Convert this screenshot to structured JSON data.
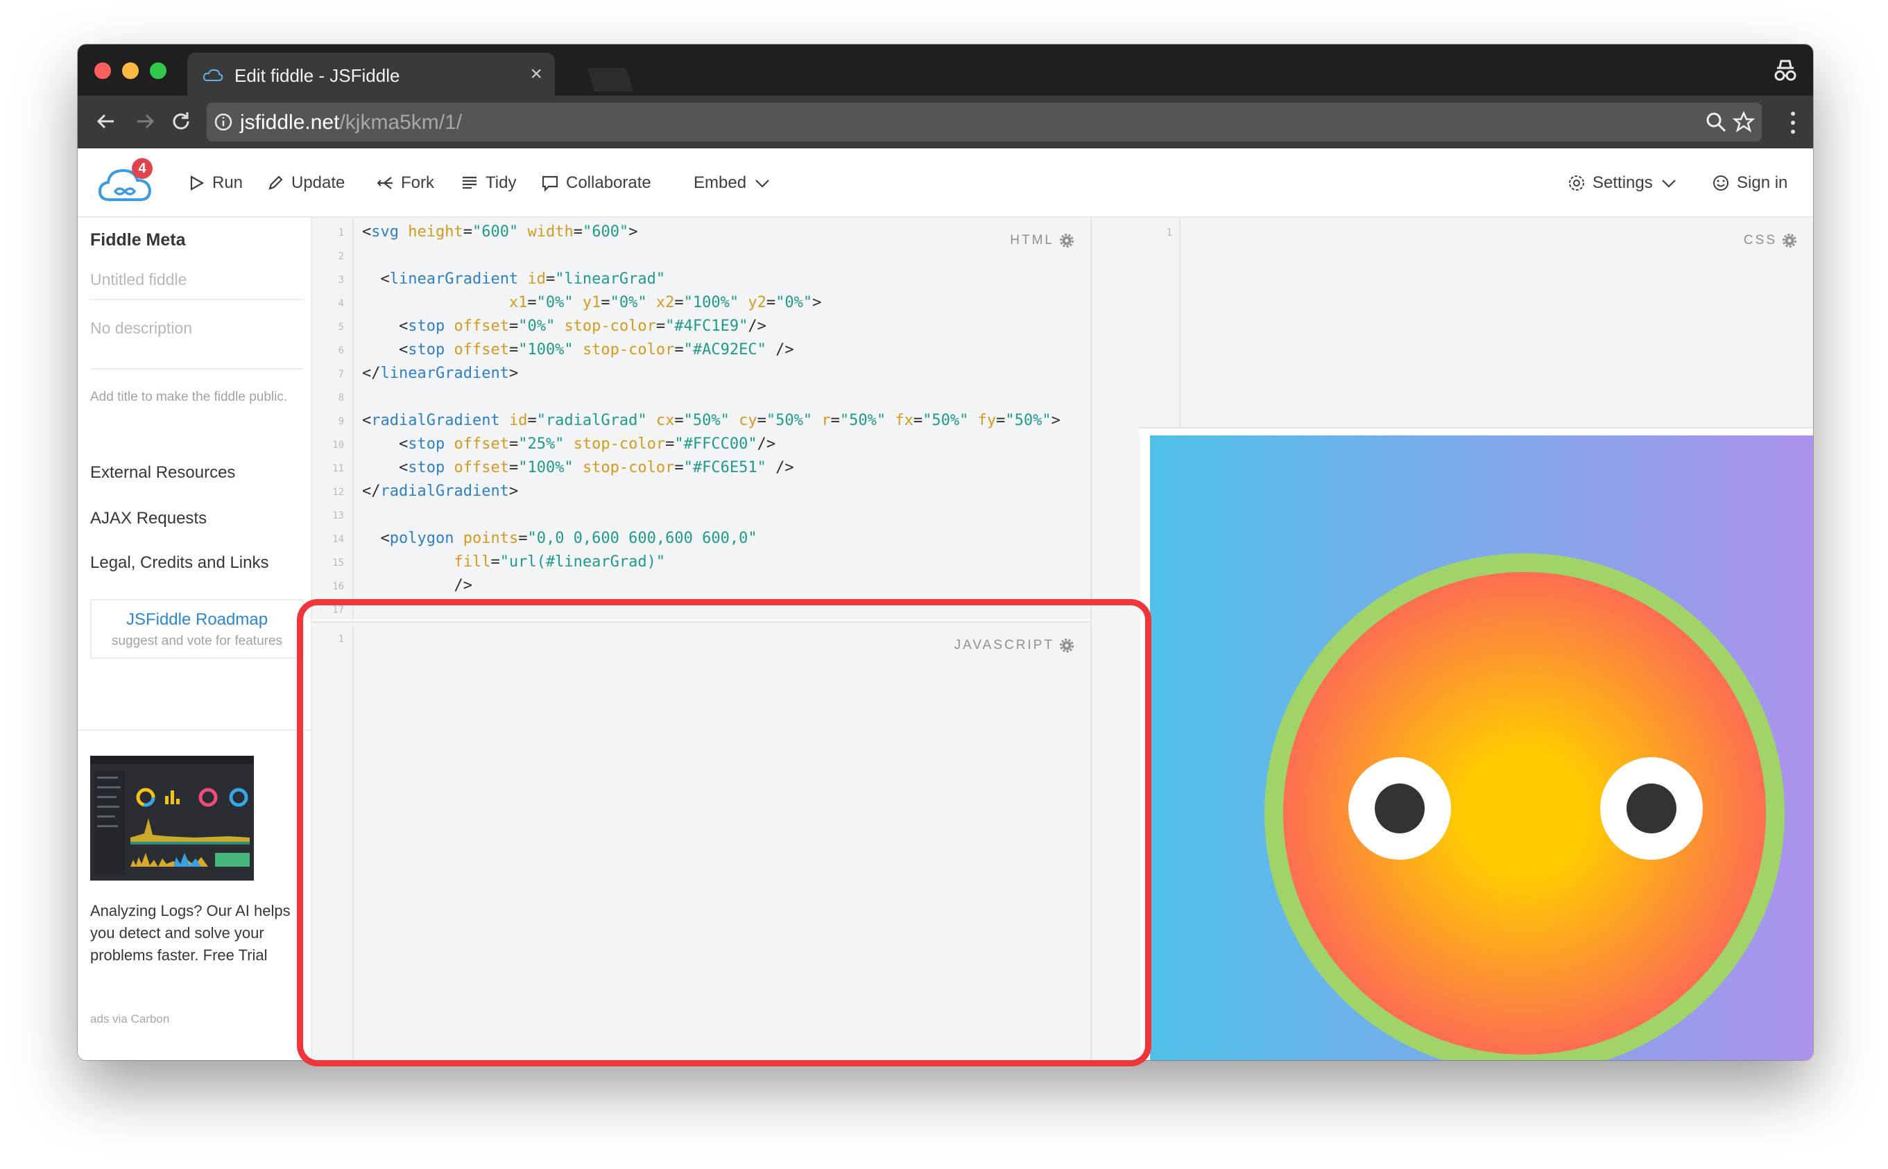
{
  "browser": {
    "tab_title": "Edit fiddle - JSFiddle",
    "tab_close": "×",
    "url_host": "jsfiddle.net",
    "url_path": "/kjkma5km/1/"
  },
  "app": {
    "badge": "4",
    "actions": {
      "run": "Run",
      "update": "Update",
      "fork": "Fork",
      "tidy": "Tidy",
      "collaborate": "Collaborate",
      "embed": "Embed",
      "settings": "Settings",
      "sign_in": "Sign in"
    }
  },
  "sidebar": {
    "title": "Fiddle Meta",
    "title_placeholder": "Untitled fiddle",
    "description_placeholder": "No description",
    "note": "Add title to make the fiddle public.",
    "links": [
      "External Resources",
      "AJAX Requests",
      "Legal, Credits and Links"
    ],
    "roadmap_title": "JSFiddle Roadmap",
    "roadmap_sub": "suggest and vote for features",
    "ad_text": "Analyzing Logs? Our AI helps you detect and solve your problems faster. Free Trial",
    "ad_via": "ads via Carbon"
  },
  "panels": {
    "html_label": "HTML",
    "css_label": "CSS",
    "js_label": "JAVASCRIPT"
  },
  "html_code": {
    "line_numbers": [
      "1",
      "2",
      "3",
      "4",
      "5",
      "6",
      "7",
      "8",
      "9",
      "10",
      "11",
      "12",
      "13",
      "14",
      "15",
      "16",
      "17"
    ],
    "css_line_numbers": [
      "1"
    ],
    "js_line_numbers": [
      "1"
    ]
  },
  "result": {
    "linear_gradient": [
      "#4FC1E9",
      "#AC92EC"
    ],
    "radial_gradient": [
      "#FFCC00",
      "#FC6E51"
    ],
    "face_ring_color": "#A0D468",
    "eye_white": "#FFFFFF",
    "pupil": "#333333"
  },
  "colors": {
    "highlight_border": "#f0353b",
    "link_blue": "#2b87d1"
  }
}
